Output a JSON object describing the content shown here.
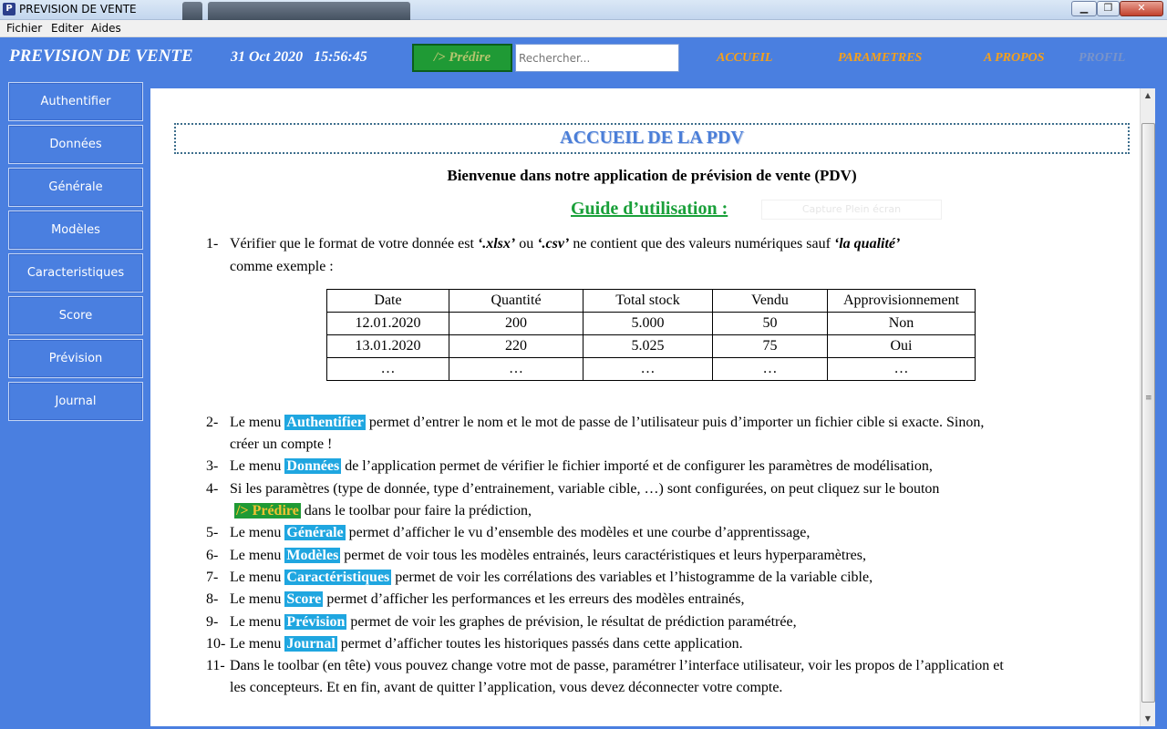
{
  "window": {
    "title": "PREVISION DE VENTE",
    "icon_letter": "P"
  },
  "menubar": {
    "items": [
      "Fichier",
      "Editer",
      "Aides"
    ]
  },
  "toolbar": {
    "app_name": "PREVISION DE VENTE",
    "date": "31 Oct 2020   15:56:45",
    "predict_label": "/> Prédire",
    "search_placeholder": "Rechercher...",
    "nav": [
      "ACCUEIL",
      "PARAMETRES",
      "A PROPOS",
      "PROFIL"
    ]
  },
  "sidebar": {
    "items": [
      "Authentifier",
      "Données",
      "Générale",
      "Modèles",
      "Caracteristiques",
      "Score",
      "Prévision",
      "Journal"
    ]
  },
  "content": {
    "heading": "ACCUEIL DE LA PDV",
    "welcome": "Bienvenue dans notre application de prévision de vente (PDV)",
    "guide_title": "Guide d’utilisation :",
    "capture_button": "Capture Plein écran",
    "step1": {
      "num": "1-",
      "a": "Vérifier que le format de votre donnée est ",
      "b": "‘.xlsx’",
      "c": " ou ",
      "d": "‘.csv’",
      "e": " ne contient que des valeurs numériques sauf ",
      "f": "‘la qualité’",
      "line2": "comme exemple :"
    },
    "table": {
      "headers": [
        "Date",
        "Quantité",
        "Total stock",
        "Vendu",
        "Approvisionnement"
      ],
      "rows": [
        [
          "12.01.2020",
          "200",
          "5.000",
          "50",
          "Non"
        ],
        [
          "13.01.2020",
          "220",
          "5.025",
          "75",
          "Oui"
        ],
        [
          "…",
          "…",
          "…",
          "…",
          "…"
        ]
      ]
    },
    "step2": {
      "num": "2-",
      "pre": "Le menu ",
      "tag": "Authentifier",
      "post": " permet d’entrer le nom et le mot de passe de l’utilisateur puis d’importer un fichier cible si exacte. Sinon,",
      "line2": "créer un compte !"
    },
    "step3": {
      "num": "3-",
      "pre": "Le menu ",
      "tag": "Données",
      "post": " de l’application permet de vérifier le fichier importé et de configurer les paramètres de modélisation,"
    },
    "step4": {
      "num": "4-",
      "line1": "Si les paramètres (type de donnée, type d’entrainement, variable cible, …) sont configurées, on peut cliquez sur le bouton",
      "tag": "/> Prédire",
      "post": " dans le toolbar pour faire la prédiction,"
    },
    "step5": {
      "num": "5-",
      "pre": "Le menu ",
      "tag": "Générale",
      "post": " permet d’afficher le vu d’ensemble des modèles et une courbe d’apprentissage,"
    },
    "step6": {
      "num": "6-",
      "pre": "Le menu ",
      "tag": "Modèles",
      "post": " permet de voir tous les modèles entrainés, leurs caractéristiques et leurs hyperparamètres,"
    },
    "step7": {
      "num": "7-",
      "pre": "Le menu ",
      "tag": "Caractéristiques",
      "post": " permet de voir les corrélations des variables et l’histogramme de la variable cible,"
    },
    "step8": {
      "num": "8-",
      "pre": "Le menu ",
      "tag": "Score",
      "post": " permet d’afficher les performances et les erreurs des modèles entrainés,"
    },
    "step9": {
      "num": "9-",
      "pre": "Le menu ",
      "tag": "Prévision",
      "post": " permet de voir les graphes de prévision, le résultat de prédiction paramétrée,"
    },
    "step10": {
      "num": "10-",
      "pre": "Le menu ",
      "tag": "Journal",
      "post": " permet d’afficher toutes les historiques passés dans cette application."
    },
    "step11": {
      "num": "11-",
      "line1": "Dans le toolbar (en tête) vous pouvez change votre mot de passe, paramétrer l’interface utilisateur, voir les propos de l’application et",
      "line2": "les concepteurs. Et en fin, avant de quitter l’application, vous devez déconnecter votre compte."
    }
  }
}
